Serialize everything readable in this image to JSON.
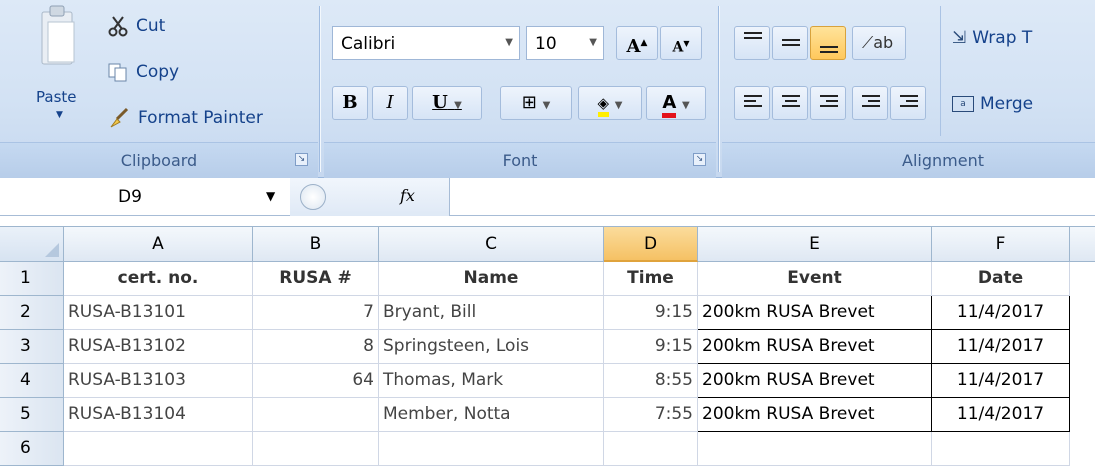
{
  "ribbon": {
    "clipboard": {
      "paste": "Paste",
      "cut": "Cut",
      "copy": "Copy",
      "format_painter": "Format Painter",
      "label": "Clipboard"
    },
    "font": {
      "font_name": "Calibri",
      "font_size": "10",
      "bold": "B",
      "italic": "I",
      "underline": "U",
      "label": "Font"
    },
    "alignment": {
      "wrap_text": "Wrap T",
      "merge": "Merge",
      "label": "Alignment"
    }
  },
  "formula_bar": {
    "name_box": "D9",
    "fx": "fx",
    "formula": ""
  },
  "sheet": {
    "columns": [
      "A",
      "B",
      "C",
      "D",
      "E",
      "F"
    ],
    "selected_column": "D",
    "rows": [
      "1",
      "2",
      "3",
      "4",
      "5",
      "6"
    ],
    "header": {
      "cert": "cert. no.",
      "rusa": "RUSA #",
      "name": "Name",
      "time": "Time",
      "event": "Event",
      "date": "Date"
    },
    "records": [
      {
        "cert": "RUSA-B13101",
        "rusa": "7",
        "name": "Bryant, Bill",
        "time": "9:15",
        "event": "200km RUSA Brevet",
        "date": "11/4/2017"
      },
      {
        "cert": "RUSA-B13102",
        "rusa": "8",
        "name": "Springsteen, Lois",
        "time": "9:15",
        "event": "200km RUSA Brevet",
        "date": "11/4/2017"
      },
      {
        "cert": "RUSA-B13103",
        "rusa": "64",
        "name": "Thomas, Mark",
        "time": "8:55",
        "event": "200km RUSA Brevet",
        "date": "11/4/2017"
      },
      {
        "cert": "RUSA-B13104",
        "rusa": "",
        "name": "Member, Notta",
        "time": "7:55",
        "event": "200km RUSA Brevet",
        "date": "11/4/2017"
      }
    ]
  },
  "colors": {
    "ribbon_bg": "#d3e2f4",
    "selected_header": "#f5c164",
    "active_align": "#ffc85c"
  }
}
